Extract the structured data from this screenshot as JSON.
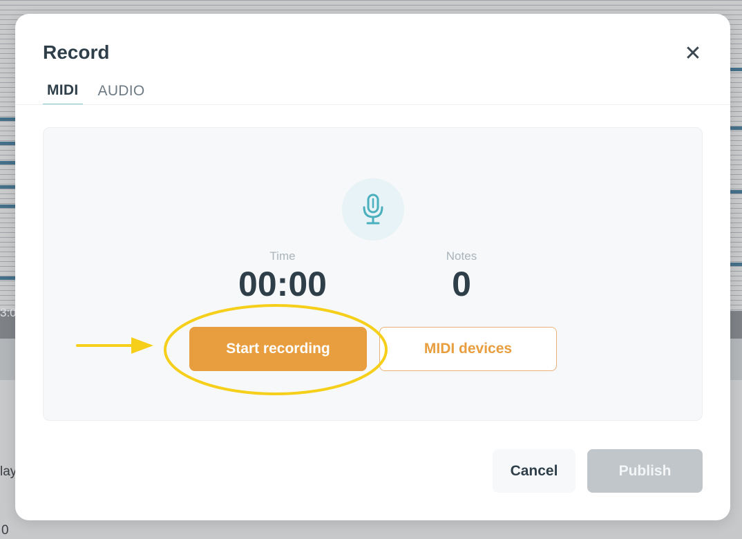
{
  "background": {
    "timeline_label": "3:0",
    "side_text": "lay",
    "bottom_text": "0"
  },
  "modal": {
    "title": "Record",
    "close_icon": "close-icon",
    "tabs": [
      {
        "label": "MIDI",
        "active": true
      },
      {
        "label": "AUDIO",
        "active": false
      }
    ],
    "recorder": {
      "mic_icon": "microphone-icon",
      "time_label": "Time",
      "time_value": "00:00",
      "notes_label": "Notes",
      "notes_value": "0",
      "start_label": "Start recording",
      "devices_label": "MIDI devices"
    },
    "footer": {
      "cancel_label": "Cancel",
      "publish_label": "Publish"
    }
  },
  "colors": {
    "accent_orange": "#e89e3e",
    "accent_teal": "#4bb0bd",
    "highlight_yellow": "#f6cf1a",
    "text_dark": "#2f3f4a",
    "disabled_gray": "#c1c6ca"
  }
}
